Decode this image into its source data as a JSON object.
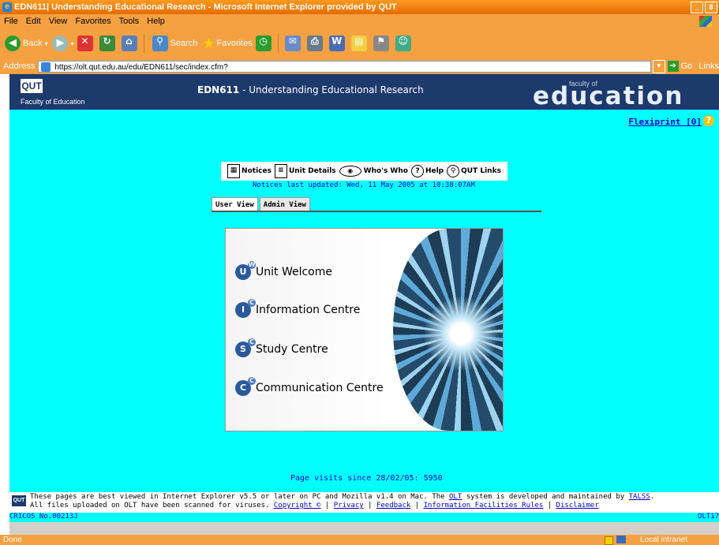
{
  "window": {
    "title": "EDN611| Understanding Educational Research - Microsoft Internet Explorer provided by QUT",
    "minimize": "_",
    "maximize": "8"
  },
  "menu": [
    "File",
    "Edit",
    "View",
    "Favorites",
    "Tools",
    "Help"
  ],
  "toolbar": {
    "back": "Back",
    "search": "Search",
    "favorites": "Favorites"
  },
  "address": {
    "label": "Address",
    "url": "https://olt.qut.edu.au/edu/EDN611/sec/index.cfm?",
    "go": "Go",
    "links": "Links"
  },
  "banner": {
    "logo": "QUT",
    "faculty": "Faculty of Education",
    "unit_code": "EDN611",
    "unit_name": " - Understanding Educational Research",
    "faculty_of": "faculty of",
    "education": "education"
  },
  "flexiprint": "Flexiprint [0]",
  "help_mark": "?",
  "nav": {
    "notices": "Notices",
    "unit_details": "Unit Details",
    "whos_who": "Who's Who",
    "help": "Help",
    "qut_links": "QUT Links"
  },
  "notices_updated": "Notices last updated: Wed, 11 May 2005 at 10:38:07AM",
  "tabs": {
    "user_view": "User View",
    "admin_view": "Admin View"
  },
  "sections": [
    {
      "label": "Unit Welcome",
      "badge": "U",
      "sup": "W"
    },
    {
      "label": "Information Centre",
      "badge": "I",
      "sup": "C"
    },
    {
      "label": "Study Centre",
      "badge": "S",
      "sup": "C"
    },
    {
      "label": "Communication Centre",
      "badge": "C",
      "sup": "C"
    }
  ],
  "visits": "Page visits since 28/02/05: 5950",
  "footer": {
    "logo": "QUT",
    "line1_a": "These pages are best viewed in Internet Explorer v5.5 or later on PC and Mozilla v1.4 on Mac. The ",
    "olt": "OLT",
    "line1_b": " system is developed and maintained by ",
    "talss": "TALSS",
    "line1_c": ".",
    "line2_a": "All files uploaded on OLT have been scanned for viruses. ",
    "copyright": "Copyright ©",
    "privacy": "Privacy",
    "feedback": "Feedback",
    "info_rules": "Information Facilities Rules",
    "disclaimer": "Disclaimer",
    "sep": " | "
  },
  "cricos": "CRICOS No.00213J",
  "olt_code": "OLT17",
  "status": {
    "done": "Done",
    "zone": "Local intranet"
  }
}
